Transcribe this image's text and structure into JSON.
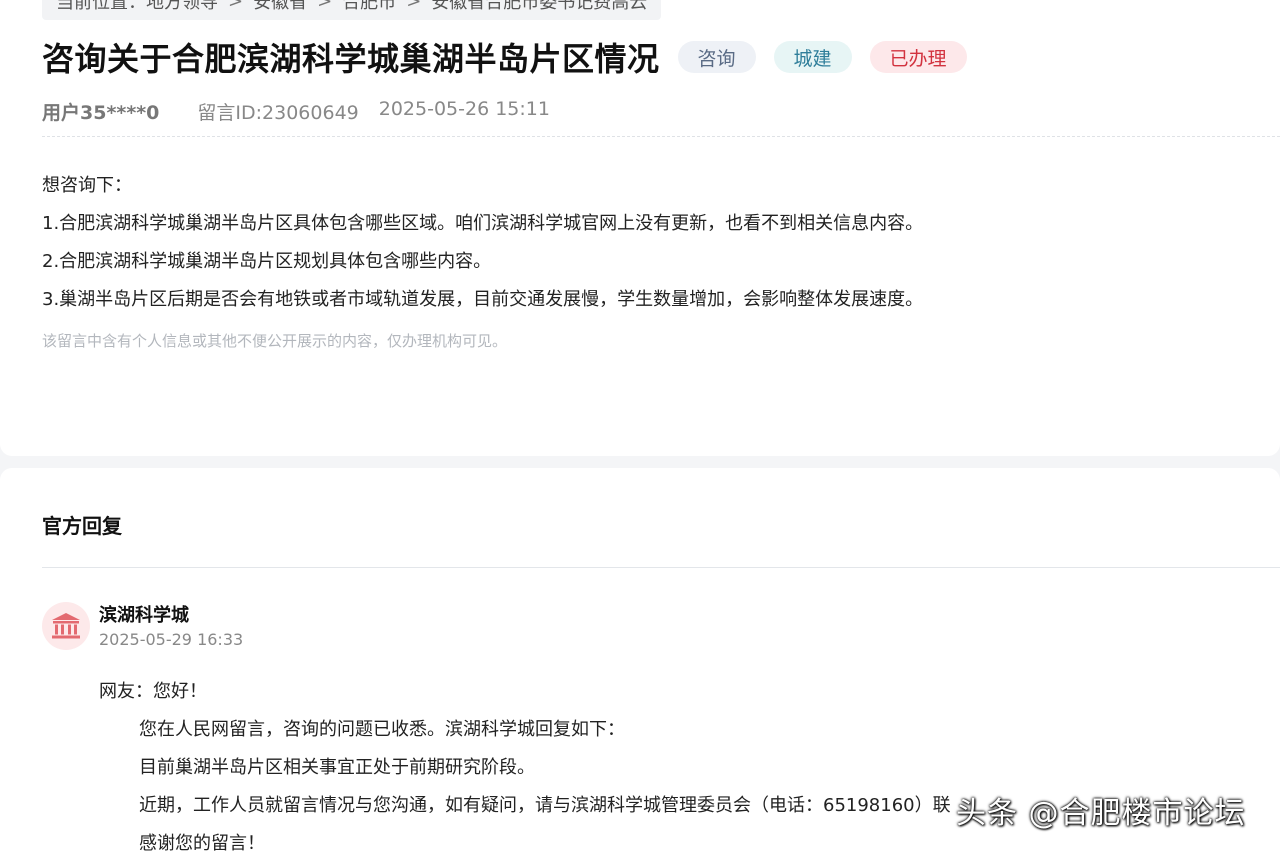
{
  "breadcrumb": {
    "items": [
      "当前位置：地方领导",
      "安徽省",
      "合肥市",
      "安徽省合肥市委书记费高云"
    ]
  },
  "message": {
    "title": "咨询关于合肥滨湖科学城巢湖半岛片区情况",
    "tags": [
      "咨询",
      "城建",
      "已办理"
    ],
    "user": "用户35****0",
    "message_id": "留言ID:23060649",
    "datetime": "2025-05-26 15:11",
    "content": [
      "想咨询下：",
      "1.合肥滨湖科学城巢湖半岛片区具体包含哪些区域。咱们滨湖科学城官网上没有更新，也看不到相关信息内容。",
      "2.合肥滨湖科学城巢湖半岛片区规划具体包含哪些内容。",
      "3.巢湖半岛片区后期是否会有地铁或者市域轨道发展，目前交通发展慢，学生数量增加，会影响整体发展速度。"
    ],
    "privacy_notice": "该留言中含有个人信息或其他不便公开展示的内容，仅办理机构可见。"
  },
  "reply": {
    "heading": "官方回复",
    "org_name": "滨湖科学城",
    "datetime": "2025-05-29 16:33",
    "greeting": "网友：您好！",
    "paragraphs": [
      "您在人民网留言，咨询的问题已收悉。滨湖科学城回复如下：",
      "目前巢湖半岛片区相关事宜正处于前期研究阶段。",
      "近期，工作人员就留言情况与您沟通，如有疑问，请与滨湖科学城管理委员会（电话：65198160）联",
      "感谢您的留言！"
    ]
  },
  "watermark": "头条 @合肥楼市论坛",
  "icons": {
    "avatar": "government-building-icon"
  },
  "colors": {
    "tag_done": "#d2323f",
    "tag_build": "#2f7e9a",
    "avatar_icon": "#e36a70"
  }
}
